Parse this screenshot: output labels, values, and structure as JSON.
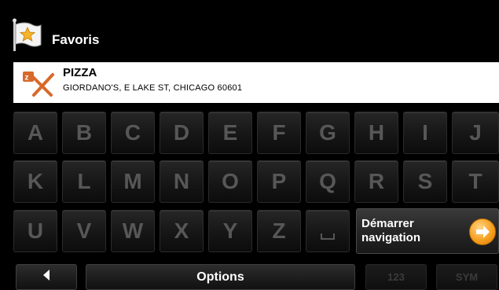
{
  "header": {
    "title": "Favoris",
    "icon": "star-flag-icon"
  },
  "result": {
    "name": "PIZZA",
    "address": "GIORDANO'S, E LAKE ST, CHICAGO 60601",
    "icon": "restaurant-icon"
  },
  "keyboard": {
    "row1": [
      "A",
      "B",
      "C",
      "D",
      "E",
      "F",
      "G",
      "H",
      "I",
      "J"
    ],
    "row2": [
      "K",
      "L",
      "M",
      "N",
      "O",
      "P",
      "Q",
      "R",
      "S",
      "T"
    ],
    "row3": [
      "U",
      "V",
      "W",
      "X",
      "Y",
      "Z"
    ],
    "space_icon": "space-bar-icon"
  },
  "start_navigation": {
    "label_line1": "Démarrer",
    "label_line2": "navigation",
    "icon": "arrow-right-circle-icon"
  },
  "bottom_bar": {
    "back_icon": "back-arrow-icon",
    "options_label": "Options",
    "numeric_label": "123",
    "symbols_label": "SYM"
  },
  "colors": {
    "accent": "#f6a020",
    "key_text": "#575757",
    "background": "#000000"
  }
}
